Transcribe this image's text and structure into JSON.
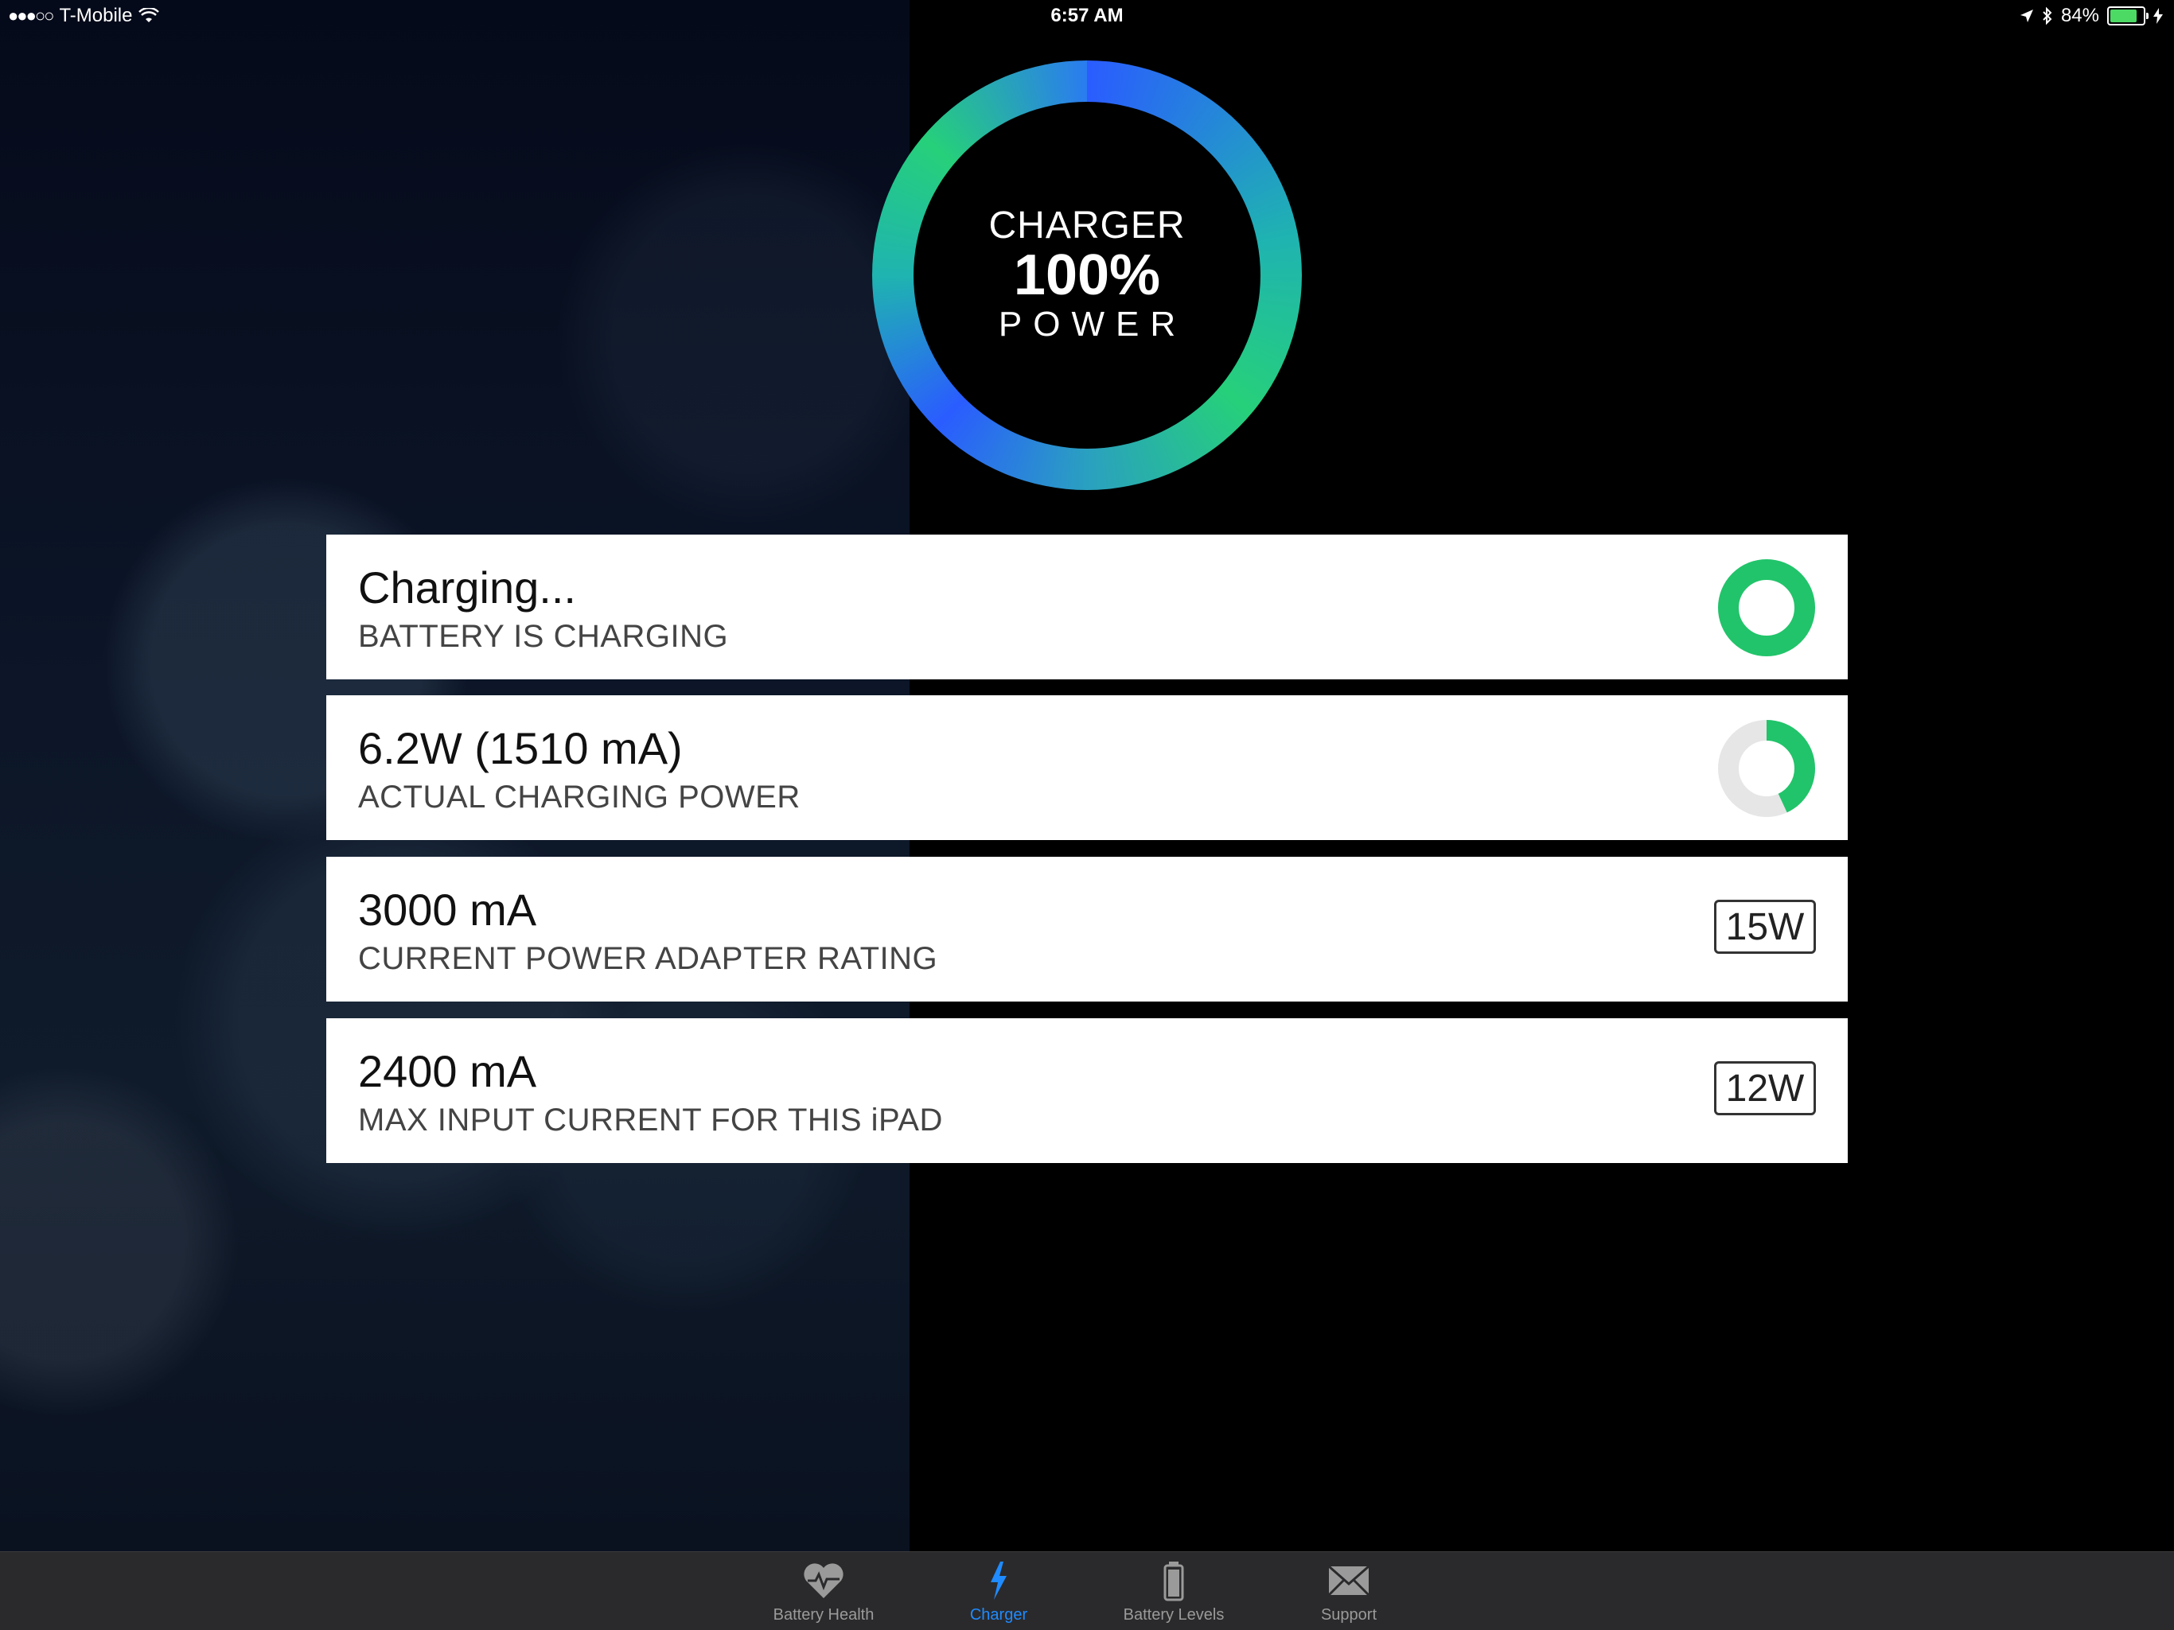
{
  "status_bar": {
    "carrier": "T-Mobile",
    "signal": "●●●○○",
    "time": "6:57 AM",
    "battery_percent": "84%",
    "battery_level": 0.84
  },
  "ring": {
    "line1": "CHARGER",
    "line2": "100%",
    "line3": "POWER"
  },
  "cards": [
    {
      "title": "Charging...",
      "subtitle": "BATTERY IS CHARGING",
      "indicator": "full-ring",
      "ring_fraction": 1.0
    },
    {
      "title": "6.2W (1510 mA)",
      "subtitle": "ACTUAL CHARGING POWER",
      "indicator": "partial-ring",
      "ring_fraction": 0.43
    },
    {
      "title": "3000 mA",
      "subtitle": "CURRENT POWER ADAPTER RATING",
      "badge": "15W"
    },
    {
      "title": "2400 mA",
      "subtitle": "MAX INPUT CURRENT FOR THIS iPAD",
      "badge": "12W"
    }
  ],
  "colors": {
    "accent_green": "#21c46a",
    "ring_track": "#e6e6e6",
    "tab_active": "#1f8bff",
    "tab_inactive": "#9a9a9a"
  },
  "tabs": [
    {
      "label": "Battery Health",
      "icon": "heart-pulse-icon",
      "active": false
    },
    {
      "label": "Charger",
      "icon": "lightning-bolt-icon",
      "active": true
    },
    {
      "label": "Battery Levels",
      "icon": "battery-icon",
      "active": false
    },
    {
      "label": "Support",
      "icon": "envelope-icon",
      "active": false
    }
  ]
}
